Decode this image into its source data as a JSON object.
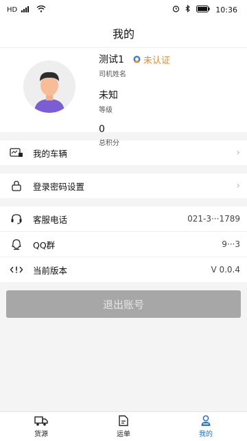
{
  "status_bar": {
    "left_indicators": "HD",
    "time": "10:36"
  },
  "header": {
    "title": "我的"
  },
  "profile": {
    "name": "测试1",
    "cert_status": "未认证",
    "name_label": "司机姓名",
    "level_value": "未知",
    "level_label": "等级",
    "points_value": "0",
    "points_label": "总积分"
  },
  "menu": {
    "vehicles": "我的车辆",
    "password": "登录密码设置",
    "service_phone_label": "客服电话",
    "service_phone_value": "021-3···1789",
    "qq_group_label": "QQ群",
    "qq_group_value": "9···3",
    "version_label": "当前版本",
    "version_value": "V 0.0.4"
  },
  "logout_label": "退出账号",
  "tabs": [
    {
      "label": "货源"
    },
    {
      "label": "运单"
    },
    {
      "label": "我的"
    }
  ],
  "colors": {
    "accent": "#1e6fd9",
    "warning": "#f08a1c",
    "logout_bg": "#a7a7a7"
  }
}
